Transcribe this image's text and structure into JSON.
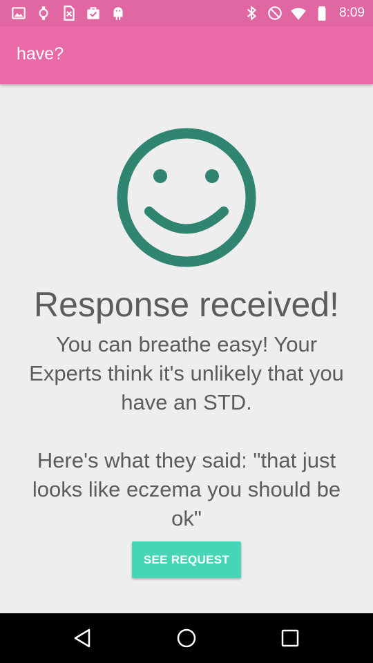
{
  "status_bar": {
    "time": "8:09",
    "left_icons": [
      "gallery-icon",
      "watch-icon",
      "sim-error-icon",
      "bag-check-icon",
      "android-icon"
    ],
    "right_icons": [
      "bluetooth-icon",
      "do-not-disturb-icon",
      "wifi-icon",
      "battery-icon"
    ]
  },
  "app_bar": {
    "title": "have?"
  },
  "main": {
    "heading": "Response received!",
    "message": "You can breathe easy! Your Experts think it's unlikely that you have an STD.",
    "quote": "Here's what they said: \"that just looks like eczema you should be ok\"",
    "button_label": "SEE REQUEST"
  },
  "nav_bar": {
    "buttons": [
      "back-icon",
      "home-icon",
      "recents-icon"
    ]
  },
  "colors": {
    "status_bar": "#e067a1",
    "app_bar": "#ea6aa8",
    "smiley": "#2f8570",
    "button": "#46d6b6",
    "text": "#5c5c5c",
    "background": "#eeeeee"
  }
}
